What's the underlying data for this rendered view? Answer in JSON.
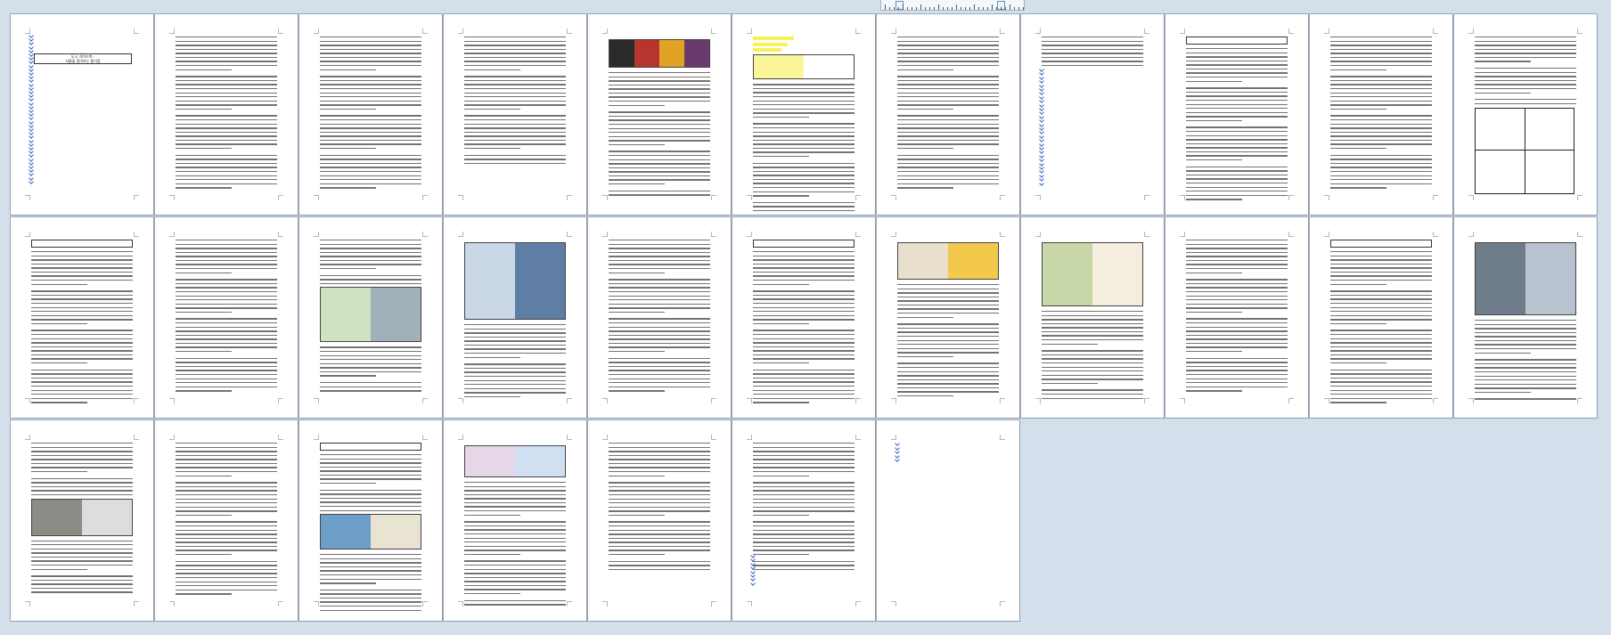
{
  "window": {
    "view_mode": "multi-page"
  },
  "title_page": {
    "line1": "도시 가이드북 -",
    "line2": "서울을 걸어보는 즐거움"
  },
  "colors": {
    "background": "#d3dfeb",
    "page": "#ffffff",
    "paragraph_mark": "#3a66c4",
    "highlight": "#f6f35a"
  },
  "icons": {
    "ruler": "horizontal-ruler",
    "margin_marker": "ruler-thumb"
  },
  "document": {
    "total_pages": 29,
    "rows": 3,
    "columns": 11
  }
}
